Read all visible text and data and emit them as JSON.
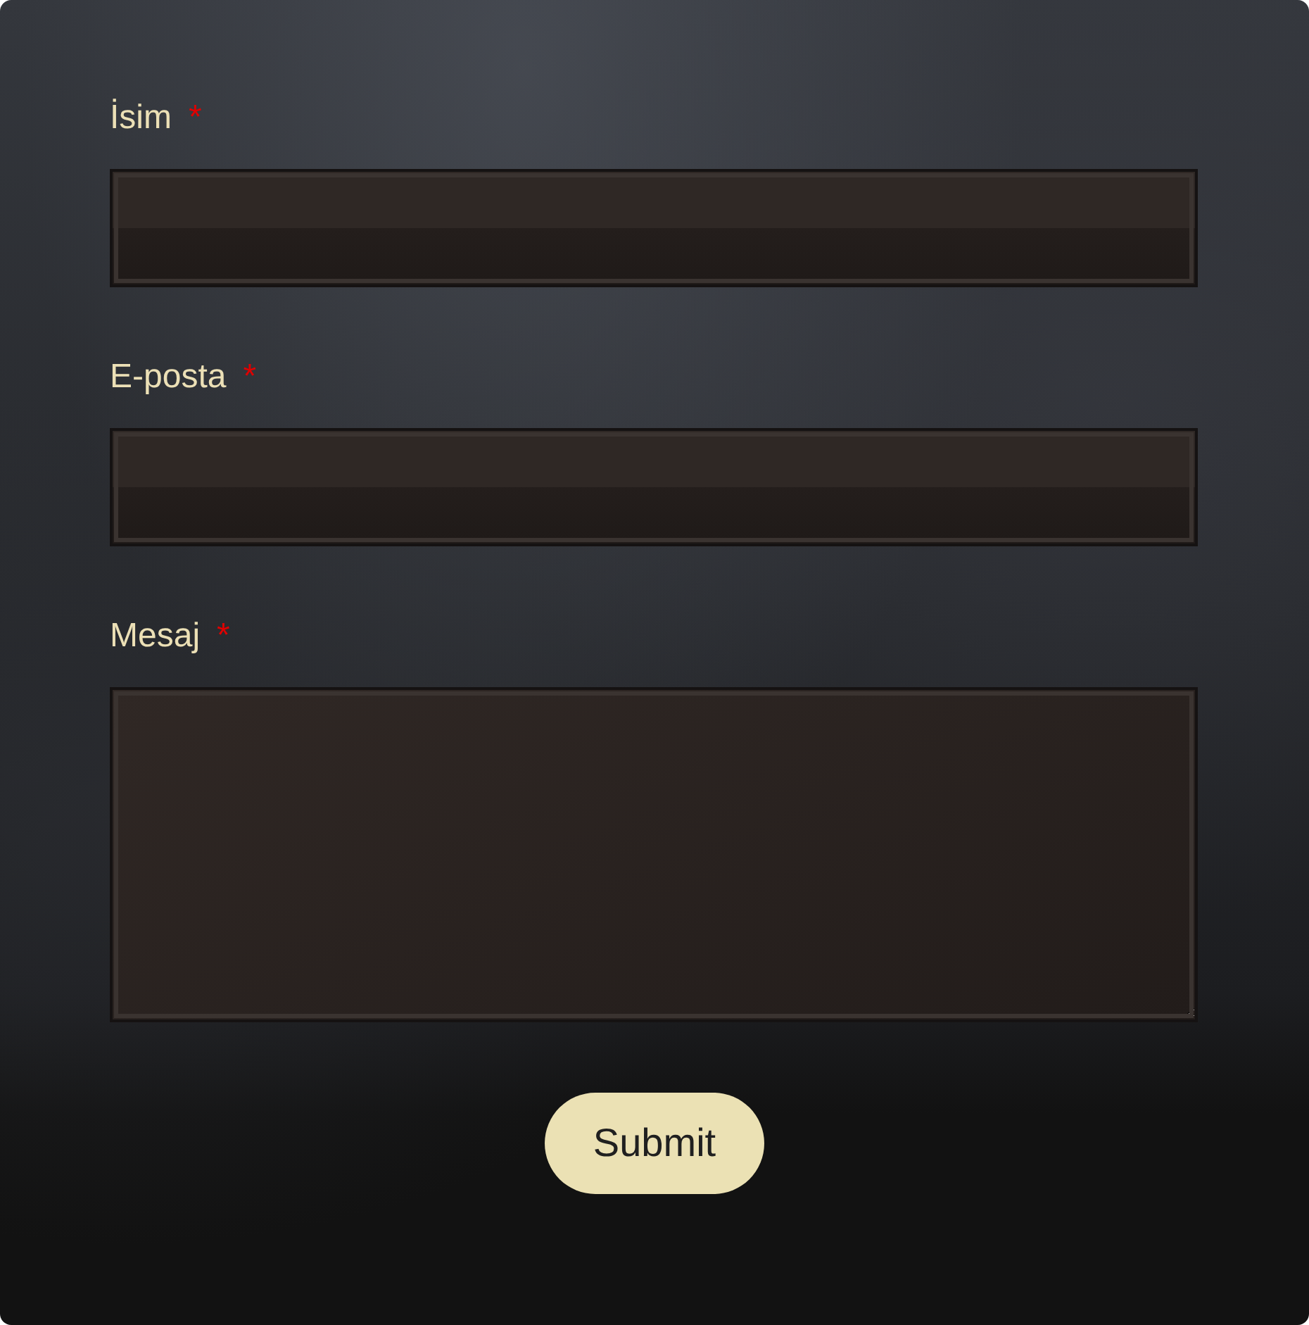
{
  "fields": [
    {
      "label": "İsim",
      "required": true,
      "required_mark": "*",
      "kind": "text"
    },
    {
      "label": "E-posta",
      "required": true,
      "required_mark": "*",
      "kind": "text"
    },
    {
      "label": "Mesaj",
      "required": true,
      "required_mark": "*",
      "kind": "textarea"
    }
  ],
  "submit": {
    "label": "Submit"
  }
}
